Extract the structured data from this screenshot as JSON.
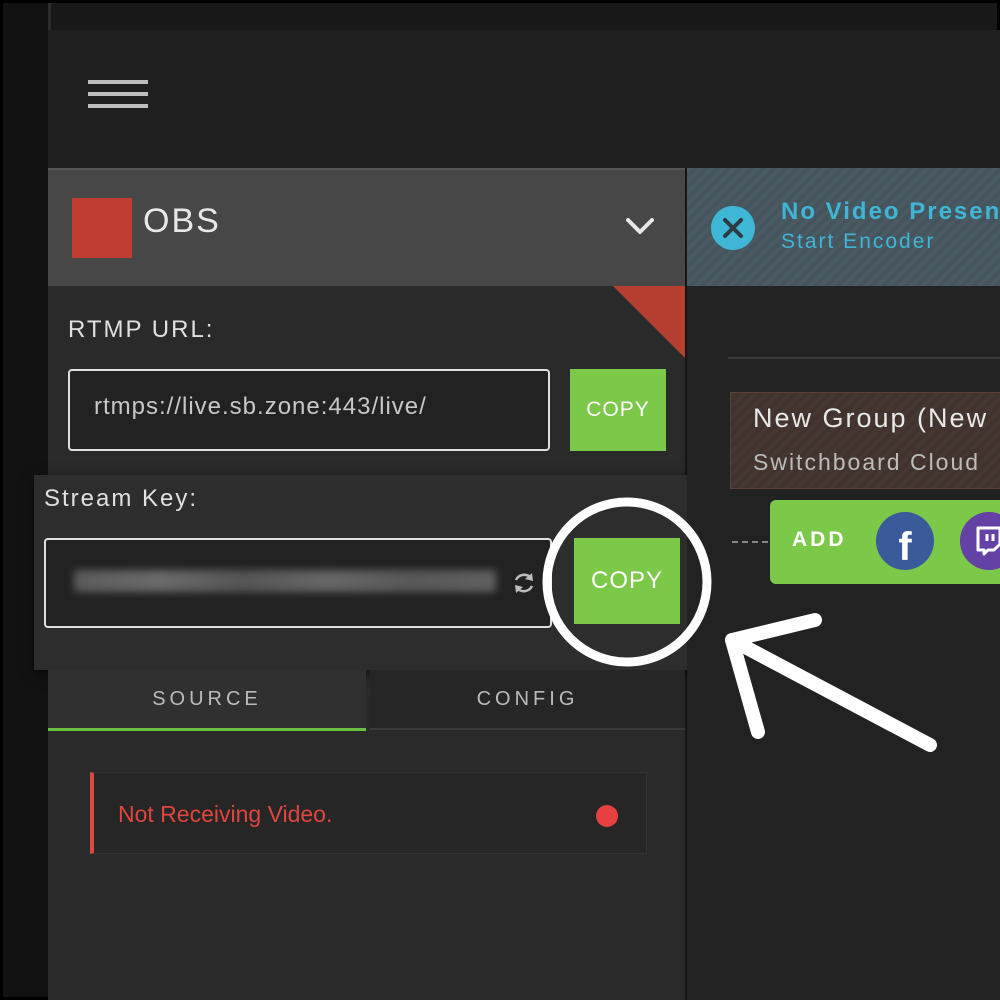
{
  "app": {
    "menu_icon": "hamburger-menu-icon"
  },
  "encoder": {
    "name": "OBS",
    "swatch_color": "#bf3e31",
    "dropdown_icon": "chevron-down-icon"
  },
  "rtmp": {
    "label": "RTMP URL:",
    "value": "rtmps://live.sb.zone:443/live/",
    "copy_label": "COPY"
  },
  "stream_key": {
    "label": "Stream Key:",
    "refresh_icon": "refresh-icon",
    "copy_label": "COPY"
  },
  "tabs": [
    {
      "label": "SOURCE",
      "active": true
    },
    {
      "label": "CONFIG",
      "active": false
    }
  ],
  "status": {
    "text": "Not Receiving Video.",
    "color": "#e0453e"
  },
  "notice": {
    "title": "No Video Present",
    "subtitle": "Start Encoder",
    "icon": "close-circle-icon"
  },
  "group": {
    "title": "New Group (New",
    "subtitle": "Switchboard Cloud"
  },
  "destinations": {
    "add_label": "ADD",
    "facebook_icon": "facebook-icon",
    "twitch_icon": "twitch-icon"
  },
  "colors": {
    "accent_green": "#7cc94a",
    "notice_blue": "#3fb6d6",
    "error_red": "#e84040"
  }
}
